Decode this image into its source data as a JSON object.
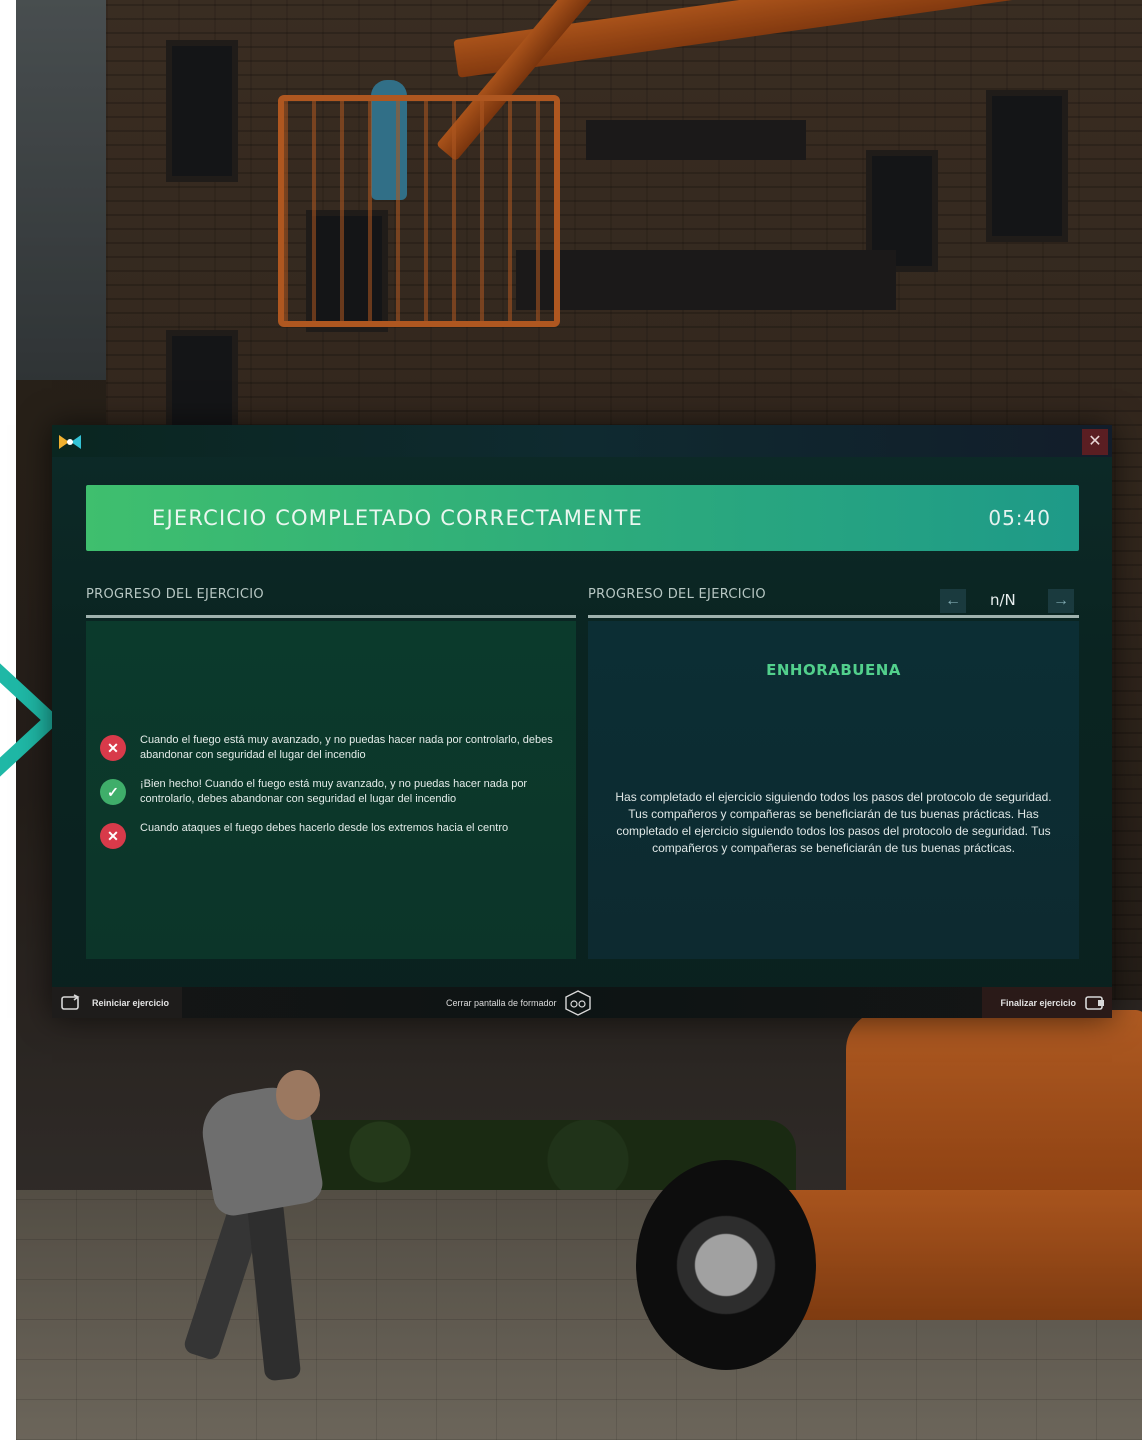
{
  "modal": {
    "banner": {
      "title": "EJERCICIO COMPLETADO CORRECTAMENTE",
      "time": "05:40",
      "gradient_colors": [
        "#3fbf6e",
        "#1e9a88"
      ]
    },
    "close_icon": "close-icon",
    "left_panel": {
      "heading": "PROGRESO DEL EJERCICIO",
      "items": [
        {
          "status": "error",
          "icon": "error-icon",
          "text": "Cuando el fuego está muy avanzado, y no puedas hacer nada por controlarlo, debes abandonar con seguridad el lugar del incendio"
        },
        {
          "status": "success",
          "icon": "check-icon",
          "text": "¡Bien hecho! Cuando el fuego está muy avanzado, y no puedas hacer nada por controlarlo, debes abandonar con seguridad el lugar del incendio"
        },
        {
          "status": "error",
          "icon": "error-icon",
          "text": "Cuando ataques el fuego debes hacerlo desde los extremos hacia el centro"
        }
      ]
    },
    "right_panel": {
      "heading": "PROGRESO DEL EJERCICIO",
      "pager": {
        "label": "n/N",
        "prev_icon": "arrow-left-icon",
        "next_icon": "arrow-right-icon"
      },
      "congrats": "ENHORABUENA",
      "summary": "Has completado el ejercicio siguiendo todos los pasos del protocolo de seguridad. Tus compañeros y compañeras se beneficiarán de tus buenas prácticas. Has completado el ejercicio siguiendo todos los pasos del protocolo de seguridad. Tus compañeros y compañeras se beneficiarán de tus buenas prácticas."
    },
    "footer": {
      "restart_label": "Reiniciar ejercicio",
      "close_trainer_label": "Cerrar pantalla de formador",
      "finish_label": "Finalizar ejercicio"
    }
  },
  "colors": {
    "accent": "#1fb8a6",
    "error": "#d83a4a",
    "success": "#3fae6a",
    "congrats": "#52d08c"
  }
}
